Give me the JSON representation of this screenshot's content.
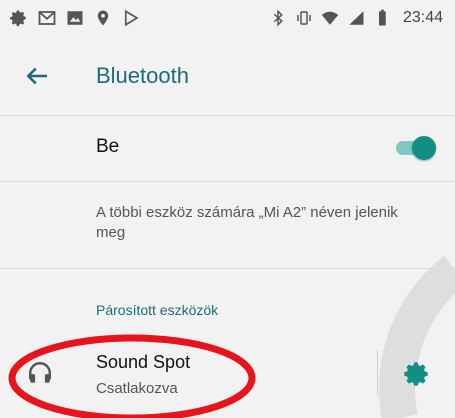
{
  "status_bar": {
    "time": "23:44",
    "left_icons": [
      "settings-icon",
      "gmail-icon",
      "image-icon",
      "location-icon",
      "play-store-icon"
    ],
    "right_icons": [
      "bluetooth-icon",
      "vibrate-icon",
      "wifi-icon",
      "signal-icon",
      "battery-icon"
    ]
  },
  "toolbar": {
    "title": "Bluetooth",
    "back_icon": "arrow-back-icon",
    "accent_color": "#1a6d77"
  },
  "bluetooth_toggle": {
    "label": "Be",
    "state": "on",
    "color": "#118f85"
  },
  "description": "A többi eszköz számára „Mi A2” néven jelenik meg",
  "paired_section": {
    "header": "Párosított eszközök",
    "devices": [
      {
        "name": "Sound Spot",
        "status": "Csatlakozva",
        "icon": "headphones-icon",
        "settings_icon": "gear-icon"
      }
    ]
  },
  "annotation": {
    "shape": "ellipse",
    "color": "#e8141b",
    "target": "Sound Spot"
  }
}
